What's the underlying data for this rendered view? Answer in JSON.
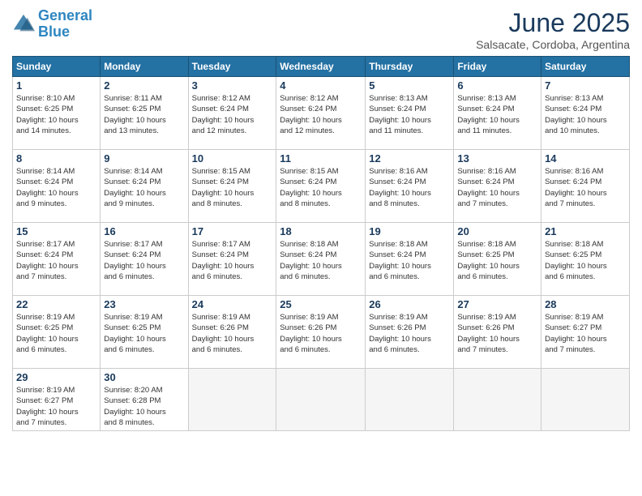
{
  "logo": {
    "line1": "General",
    "line2": "Blue"
  },
  "title": "June 2025",
  "subtitle": "Salsacate, Cordoba, Argentina",
  "days_header": [
    "Sunday",
    "Monday",
    "Tuesday",
    "Wednesday",
    "Thursday",
    "Friday",
    "Saturday"
  ],
  "weeks": [
    [
      {
        "num": "1",
        "info": "Sunrise: 8:10 AM\nSunset: 6:25 PM\nDaylight: 10 hours\nand 14 minutes."
      },
      {
        "num": "2",
        "info": "Sunrise: 8:11 AM\nSunset: 6:25 PM\nDaylight: 10 hours\nand 13 minutes."
      },
      {
        "num": "3",
        "info": "Sunrise: 8:12 AM\nSunset: 6:24 PM\nDaylight: 10 hours\nand 12 minutes."
      },
      {
        "num": "4",
        "info": "Sunrise: 8:12 AM\nSunset: 6:24 PM\nDaylight: 10 hours\nand 12 minutes."
      },
      {
        "num": "5",
        "info": "Sunrise: 8:13 AM\nSunset: 6:24 PM\nDaylight: 10 hours\nand 11 minutes."
      },
      {
        "num": "6",
        "info": "Sunrise: 8:13 AM\nSunset: 6:24 PM\nDaylight: 10 hours\nand 11 minutes."
      },
      {
        "num": "7",
        "info": "Sunrise: 8:13 AM\nSunset: 6:24 PM\nDaylight: 10 hours\nand 10 minutes."
      }
    ],
    [
      {
        "num": "8",
        "info": "Sunrise: 8:14 AM\nSunset: 6:24 PM\nDaylight: 10 hours\nand 9 minutes."
      },
      {
        "num": "9",
        "info": "Sunrise: 8:14 AM\nSunset: 6:24 PM\nDaylight: 10 hours\nand 9 minutes."
      },
      {
        "num": "10",
        "info": "Sunrise: 8:15 AM\nSunset: 6:24 PM\nDaylight: 10 hours\nand 8 minutes."
      },
      {
        "num": "11",
        "info": "Sunrise: 8:15 AM\nSunset: 6:24 PM\nDaylight: 10 hours\nand 8 minutes."
      },
      {
        "num": "12",
        "info": "Sunrise: 8:16 AM\nSunset: 6:24 PM\nDaylight: 10 hours\nand 8 minutes."
      },
      {
        "num": "13",
        "info": "Sunrise: 8:16 AM\nSunset: 6:24 PM\nDaylight: 10 hours\nand 7 minutes."
      },
      {
        "num": "14",
        "info": "Sunrise: 8:16 AM\nSunset: 6:24 PM\nDaylight: 10 hours\nand 7 minutes."
      }
    ],
    [
      {
        "num": "15",
        "info": "Sunrise: 8:17 AM\nSunset: 6:24 PM\nDaylight: 10 hours\nand 7 minutes."
      },
      {
        "num": "16",
        "info": "Sunrise: 8:17 AM\nSunset: 6:24 PM\nDaylight: 10 hours\nand 6 minutes."
      },
      {
        "num": "17",
        "info": "Sunrise: 8:17 AM\nSunset: 6:24 PM\nDaylight: 10 hours\nand 6 minutes."
      },
      {
        "num": "18",
        "info": "Sunrise: 8:18 AM\nSunset: 6:24 PM\nDaylight: 10 hours\nand 6 minutes."
      },
      {
        "num": "19",
        "info": "Sunrise: 8:18 AM\nSunset: 6:24 PM\nDaylight: 10 hours\nand 6 minutes."
      },
      {
        "num": "20",
        "info": "Sunrise: 8:18 AM\nSunset: 6:25 PM\nDaylight: 10 hours\nand 6 minutes."
      },
      {
        "num": "21",
        "info": "Sunrise: 8:18 AM\nSunset: 6:25 PM\nDaylight: 10 hours\nand 6 minutes."
      }
    ],
    [
      {
        "num": "22",
        "info": "Sunrise: 8:19 AM\nSunset: 6:25 PM\nDaylight: 10 hours\nand 6 minutes."
      },
      {
        "num": "23",
        "info": "Sunrise: 8:19 AM\nSunset: 6:25 PM\nDaylight: 10 hours\nand 6 minutes."
      },
      {
        "num": "24",
        "info": "Sunrise: 8:19 AM\nSunset: 6:26 PM\nDaylight: 10 hours\nand 6 minutes."
      },
      {
        "num": "25",
        "info": "Sunrise: 8:19 AM\nSunset: 6:26 PM\nDaylight: 10 hours\nand 6 minutes."
      },
      {
        "num": "26",
        "info": "Sunrise: 8:19 AM\nSunset: 6:26 PM\nDaylight: 10 hours\nand 6 minutes."
      },
      {
        "num": "27",
        "info": "Sunrise: 8:19 AM\nSunset: 6:26 PM\nDaylight: 10 hours\nand 7 minutes."
      },
      {
        "num": "28",
        "info": "Sunrise: 8:19 AM\nSunset: 6:27 PM\nDaylight: 10 hours\nand 7 minutes."
      }
    ],
    [
      {
        "num": "29",
        "info": "Sunrise: 8:19 AM\nSunset: 6:27 PM\nDaylight: 10 hours\nand 7 minutes."
      },
      {
        "num": "30",
        "info": "Sunrise: 8:20 AM\nSunset: 6:28 PM\nDaylight: 10 hours\nand 8 minutes."
      },
      {
        "num": "",
        "info": ""
      },
      {
        "num": "",
        "info": ""
      },
      {
        "num": "",
        "info": ""
      },
      {
        "num": "",
        "info": ""
      },
      {
        "num": "",
        "info": ""
      }
    ]
  ]
}
